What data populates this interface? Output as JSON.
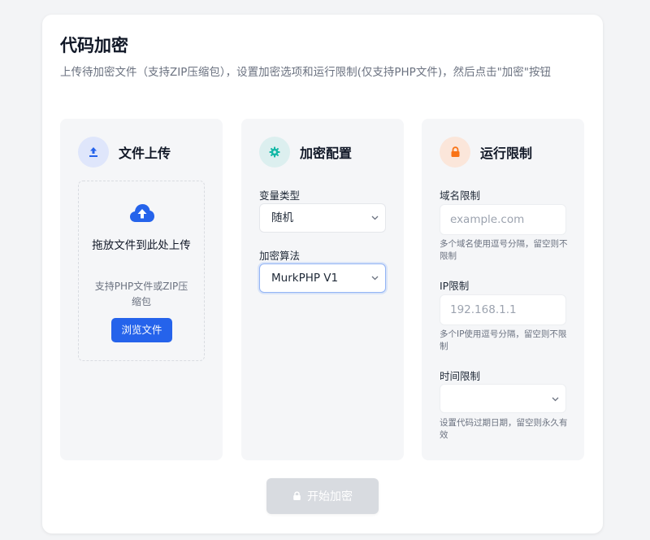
{
  "header": {
    "title": "代码加密",
    "subtitle": "上传待加密文件（支持ZIP压缩包），设置加密选项和运行限制(仅支持PHP文件)，然后点击\"加密\"按钮"
  },
  "upload_panel": {
    "title": "文件上传",
    "icon": "upload-icon",
    "drop_title": "拖放文件到此处上传",
    "drop_hint": "支持PHP文件或ZIP压缩包",
    "browse_label": "浏览文件"
  },
  "config_panel": {
    "title": "加密配置",
    "icon": "gear-icon",
    "variable_type_label": "变量类型",
    "variable_type_value": "随机",
    "algorithm_label": "加密算法",
    "algorithm_value": "MurkPHP V1"
  },
  "limits_panel": {
    "title": "运行限制",
    "icon": "lock-icon",
    "domain_label": "域名限制",
    "domain_placeholder": "example.com",
    "domain_help": "多个域名使用逗号分隔，留空则不限制",
    "ip_label": "IP限制",
    "ip_placeholder": "192.168.1.1",
    "ip_help": "多个IP使用逗号分隔，留空则不限制",
    "time_label": "时间限制",
    "time_value": "",
    "time_help": "设置代码过期日期，留空则永久有效"
  },
  "actions": {
    "submit_label": "开始加密"
  },
  "colors": {
    "primary": "#2563eb",
    "upload_circle": "#dfe6fb",
    "config_circle": "#dcefef",
    "config_accent": "#14b8a6",
    "limits_circle": "#fbe6da",
    "limits_accent": "#f97316",
    "disabled_button": "#d8dbe0"
  }
}
